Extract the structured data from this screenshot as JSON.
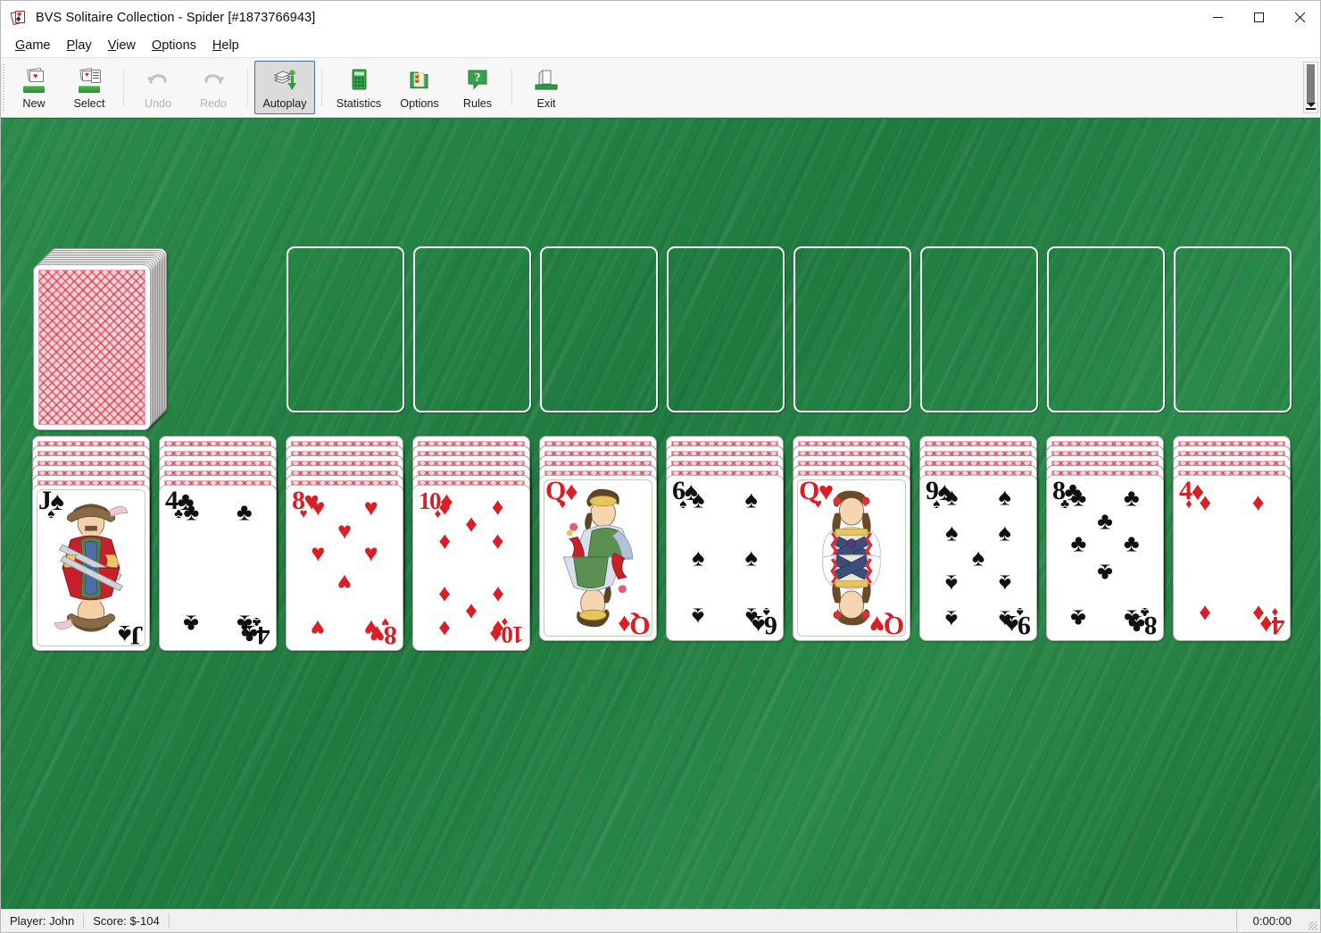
{
  "window": {
    "app_name": "BVS Solitaire Collection",
    "separator": "-",
    "game_name": "Spider",
    "game_id": "[#1873766943]",
    "title": "BVS Solitaire Collection  -  Spider [#1873766943]",
    "icon": "cards-app-icon",
    "controls": {
      "minimize": "minimize-icon",
      "maximize": "maximize-icon",
      "close": "close-icon"
    }
  },
  "menu": {
    "items": [
      {
        "label": "Game",
        "accel": "G"
      },
      {
        "label": "Play",
        "accel": "P"
      },
      {
        "label": "View",
        "accel": "V"
      },
      {
        "label": "Options",
        "accel": "O"
      },
      {
        "label": "Help",
        "accel": "H"
      }
    ]
  },
  "toolbar": {
    "buttons": [
      {
        "label": "New",
        "icon": "new-game-icon",
        "enabled": true,
        "active": false
      },
      {
        "label": "Select",
        "icon": "select-game-icon",
        "enabled": true,
        "active": false
      },
      {
        "label": "Undo",
        "icon": "undo-arrow-icon",
        "enabled": false,
        "active": false
      },
      {
        "label": "Redo",
        "icon": "redo-arrow-icon",
        "enabled": false,
        "active": false
      },
      {
        "label": "Autoplay",
        "icon": "autoplay-icon",
        "enabled": true,
        "active": true
      },
      {
        "label": "Statistics",
        "icon": "statistics-icon",
        "enabled": true,
        "active": false
      },
      {
        "label": "Options",
        "icon": "options-icon",
        "enabled": true,
        "active": false
      },
      {
        "label": "Rules",
        "icon": "rules-help-icon",
        "enabled": true,
        "active": false
      },
      {
        "label": "Exit",
        "icon": "exit-door-icon",
        "enabled": true,
        "active": false
      }
    ],
    "overflow": "toolbar-overflow-icon"
  },
  "table": {
    "felt_color": "#238143",
    "stock": {
      "name": "stock-pile",
      "face_down_count": 10,
      "card_back": "red-plaid-back"
    },
    "foundations": [
      {
        "name": "foundation-slot-1",
        "empty": true
      },
      {
        "name": "foundation-slot-2",
        "empty": true
      },
      {
        "name": "foundation-slot-3",
        "empty": true
      },
      {
        "name": "foundation-slot-4",
        "empty": true
      },
      {
        "name": "foundation-slot-5",
        "empty": true
      },
      {
        "name": "foundation-slot-6",
        "empty": true
      },
      {
        "name": "foundation-slot-7",
        "empty": true
      },
      {
        "name": "foundation-slot-8",
        "empty": true
      }
    ],
    "tableau": [
      {
        "column": 1,
        "face_down": 5,
        "top_card": {
          "rank": "J",
          "suit": "spades",
          "color": "black",
          "type": "court"
        }
      },
      {
        "column": 2,
        "face_down": 5,
        "top_card": {
          "rank": "4",
          "suit": "clubs",
          "color": "black",
          "type": "pip"
        }
      },
      {
        "column": 3,
        "face_down": 5,
        "top_card": {
          "rank": "8",
          "suit": "hearts",
          "color": "red",
          "type": "pip"
        }
      },
      {
        "column": 4,
        "face_down": 5,
        "top_card": {
          "rank": "10",
          "suit": "diamonds",
          "color": "red",
          "type": "pip"
        }
      },
      {
        "column": 5,
        "face_down": 4,
        "top_card": {
          "rank": "Q",
          "suit": "diamonds",
          "color": "red",
          "type": "court"
        }
      },
      {
        "column": 6,
        "face_down": 4,
        "top_card": {
          "rank": "6",
          "suit": "spades",
          "color": "black",
          "type": "pip"
        }
      },
      {
        "column": 7,
        "face_down": 4,
        "top_card": {
          "rank": "Q",
          "suit": "hearts",
          "color": "red",
          "type": "court"
        }
      },
      {
        "column": 8,
        "face_down": 4,
        "top_card": {
          "rank": "9",
          "suit": "spades",
          "color": "black",
          "type": "pip"
        }
      },
      {
        "column": 9,
        "face_down": 4,
        "top_card": {
          "rank": "8",
          "suit": "clubs",
          "color": "black",
          "type": "pip"
        }
      },
      {
        "column": 10,
        "face_down": 4,
        "top_card": {
          "rank": "4",
          "suit": "diamonds",
          "color": "red",
          "type": "pip"
        }
      }
    ]
  },
  "status_bar": {
    "player_label": "Player: John",
    "score_label": "Score: $-104",
    "timer": "0:00:00",
    "resize_grip": "resize-grip-icon"
  },
  "colors": {
    "felt": "#238143",
    "card_red": "#d91f26",
    "card_black": "#101010",
    "card_back_red": "#d6344a",
    "toolbar_bg": "#f7f7f7",
    "status_bg": "#f0f0f0",
    "active_button": "#dbdbdb"
  }
}
